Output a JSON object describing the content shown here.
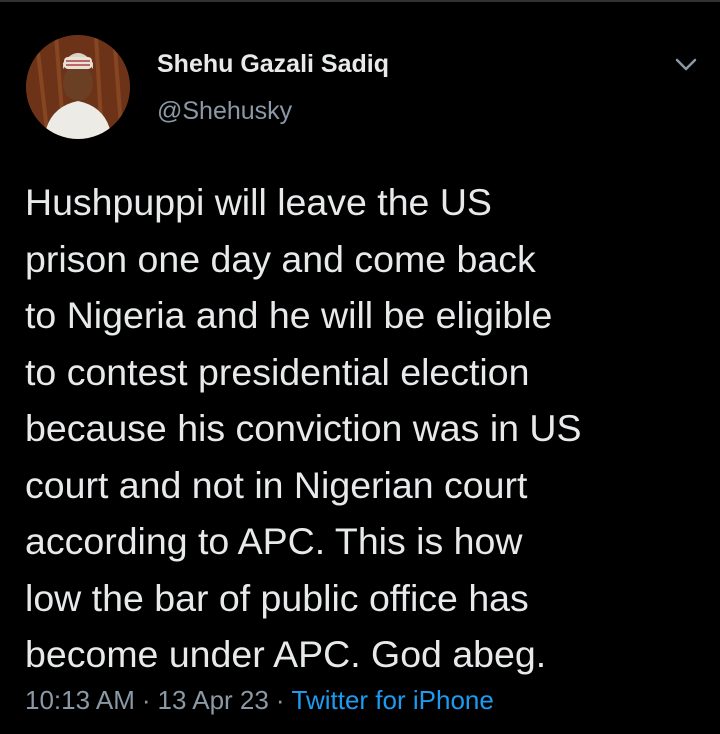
{
  "tweet": {
    "author": {
      "display_name": "Shehu Gazali Sadiq",
      "handle": "@Shehusky"
    },
    "text": "Hushpuppi will leave the US\nprison one day and come back\nto Nigeria and he will be eligible\nto contest presidential election\nbecause his conviction was in US\ncourt and not in Nigerian court\naccording to APC. This is how\nlow the bar of public office has\nbecome under APC. God abeg.",
    "time": "10:13 AM",
    "separator": "·",
    "date": "13 Apr 23",
    "source": "Twitter for iPhone"
  },
  "icons": {
    "menu": "chevron-down-icon"
  },
  "colors": {
    "background": "#000000",
    "text": "#e7e9ea",
    "muted": "#8b98a5",
    "link": "#1d9bf0"
  }
}
